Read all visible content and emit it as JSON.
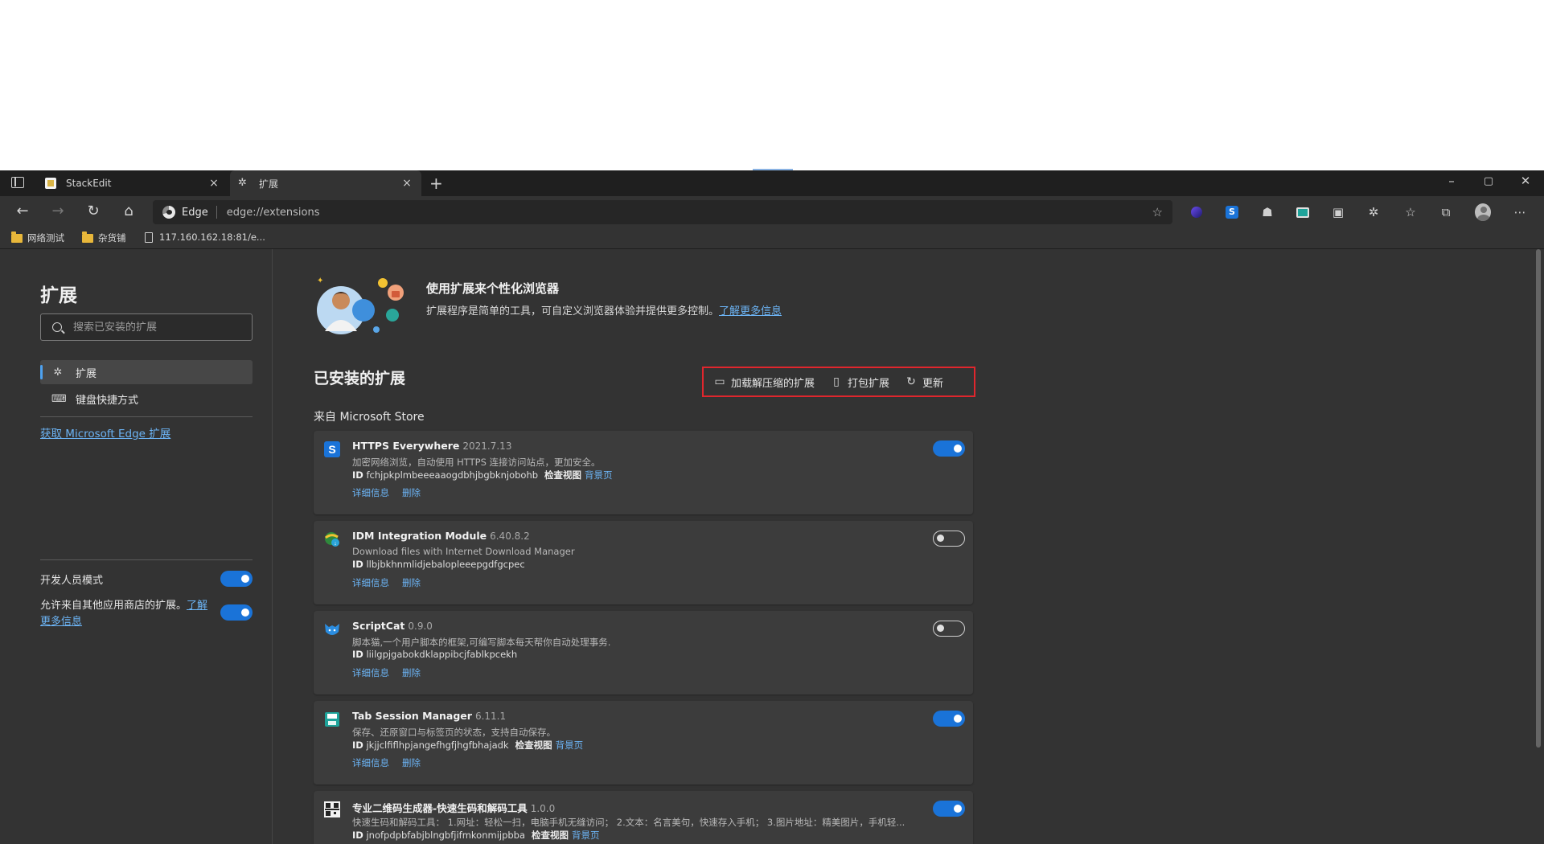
{
  "tabs": [
    {
      "label": "StackEdit",
      "close": "×"
    },
    {
      "label": "扩展",
      "close": "×"
    }
  ],
  "new_tab": "+",
  "window_controls": {
    "minimize": "–",
    "restore": "▢",
    "close": "✕"
  },
  "address": {
    "brand": "Edge",
    "url": "edge://extensions"
  },
  "bookmarks": [
    {
      "label": "网络测试",
      "icon": "folder-icon"
    },
    {
      "label": "杂货铺",
      "icon": "folder-icon"
    },
    {
      "label": "117.160.162.18:81/e...",
      "icon": "page-icon"
    }
  ],
  "sidebar": {
    "title": "扩展",
    "search_placeholder": "搜索已安装的扩展",
    "items": [
      {
        "label": "扩展",
        "icon": "puzzle-icon",
        "selected": true
      },
      {
        "label": "键盘快捷方式",
        "icon": "keyboard-icon",
        "selected": false
      }
    ],
    "get_extensions_link": "获取 Microsoft Edge 扩展",
    "dev_mode_label": "开发人员模式",
    "allow_other_stores_label": "允许来自其他应用商店的扩展。",
    "learn_more": "了解更多信息"
  },
  "hero": {
    "title": "使用扩展来个性化浏览器",
    "description": "扩展程序是简单的工具，可自定义浏览器体验并提供更多控制。",
    "learn_more": "了解更多信息"
  },
  "installed": {
    "title": "已安装的扩展",
    "actions": [
      {
        "label": "加载解压缩的扩展",
        "icon": "archive-icon"
      },
      {
        "label": "打包扩展",
        "icon": "package-icon"
      },
      {
        "label": "更新",
        "icon": "refresh-icon"
      }
    ],
    "source": "来自 Microsoft Store"
  },
  "extensions": [
    {
      "name": "HTTPS Everywhere",
      "version": "2021.7.13",
      "description": "加密网络浏览，自动使用 HTTPS 连接访问站点，更加安全。",
      "id_label": "ID",
      "id": "fchjpkplmbeeeaaogdbhjbgbknjobohb",
      "inspect": "检查视图",
      "bg_page": "背景页",
      "details": "详细信息",
      "remove": "删除",
      "enabled": true,
      "icon": "https-everywhere-icon"
    },
    {
      "name": "IDM Integration Module",
      "version": "6.40.8.2",
      "description": "Download files with Internet Download Manager",
      "id_label": "ID",
      "id": "llbjbkhnmlidjebalopleeepgdfgcpec",
      "inspect": "",
      "bg_page": "",
      "details": "详细信息",
      "remove": "删除",
      "enabled": false,
      "icon": "idm-icon"
    },
    {
      "name": "ScriptCat",
      "version": "0.9.0",
      "description": "脚本猫,一个用户脚本的框架,可编写脚本每天帮你自动处理事务.",
      "id_label": "ID",
      "id": "liilgpjgabokdklappibcjfablkpcekh",
      "inspect": "",
      "bg_page": "",
      "details": "详细信息",
      "remove": "删除",
      "enabled": false,
      "icon": "scriptcat-icon"
    },
    {
      "name": "Tab Session Manager",
      "version": "6.11.1",
      "description": "保存、还原窗口与标签页的状态，支持自动保存。",
      "id_label": "ID",
      "id": "jkjjclfiflhpjangefhgfjhgfbhajadk",
      "inspect": "检查视图",
      "bg_page": "背景页",
      "details": "详细信息",
      "remove": "删除",
      "enabled": true,
      "icon": "tab-session-icon"
    },
    {
      "name": "专业二维码生成器-快速生码和解码工具",
      "version": "1.0.0",
      "description": "快速生码和解码工具： 1.网址：轻松一扫，电脑手机无缝访问； 2.文本：名言美句，快速存入手机； 3.图片地址：精美图片，手机轻...",
      "id_label": "ID",
      "id": "jnofpdpbfabjblngbfjifmkonmijpbba",
      "inspect": "检查视图",
      "bg_page": "背景页",
      "details": "",
      "remove": "",
      "enabled": true,
      "icon": "qrcode-icon"
    }
  ],
  "colors": {
    "accent": "#1a73d8",
    "link": "#6cb4f5",
    "highlight_box": "#e0262d",
    "background": "#333333"
  }
}
